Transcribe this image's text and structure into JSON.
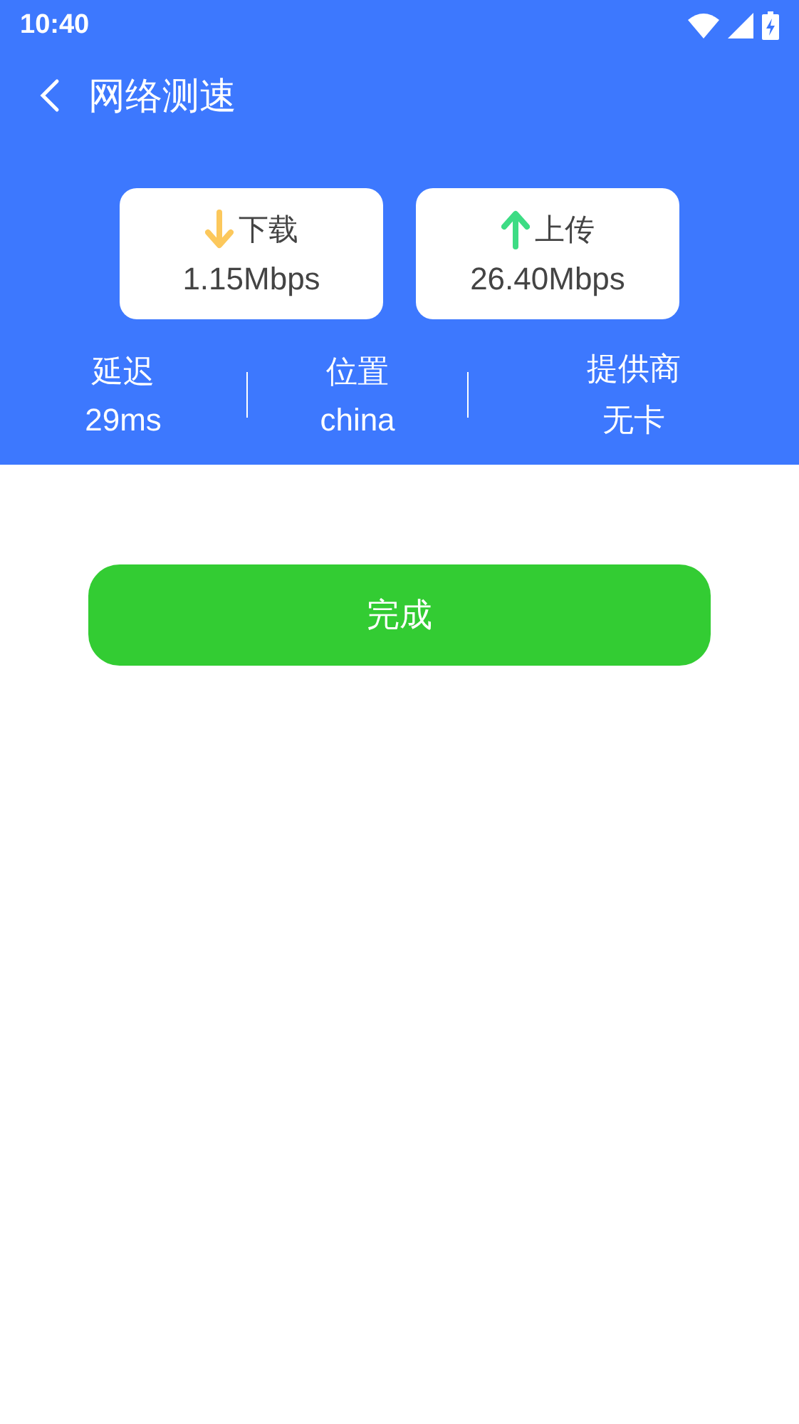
{
  "status_bar": {
    "time": "10:40"
  },
  "header": {
    "title": "网络测速"
  },
  "speeds": [
    {
      "kind": "download",
      "label": "下载",
      "value": "1.15Mbps"
    },
    {
      "kind": "upload",
      "label": "上传",
      "value": "26.40Mbps"
    }
  ],
  "stats": [
    {
      "label": "延迟",
      "value": "29ms"
    },
    {
      "label": "位置",
      "value": "china"
    },
    {
      "label": "提供商",
      "value": "无卡"
    }
  ],
  "done_button": "完成"
}
